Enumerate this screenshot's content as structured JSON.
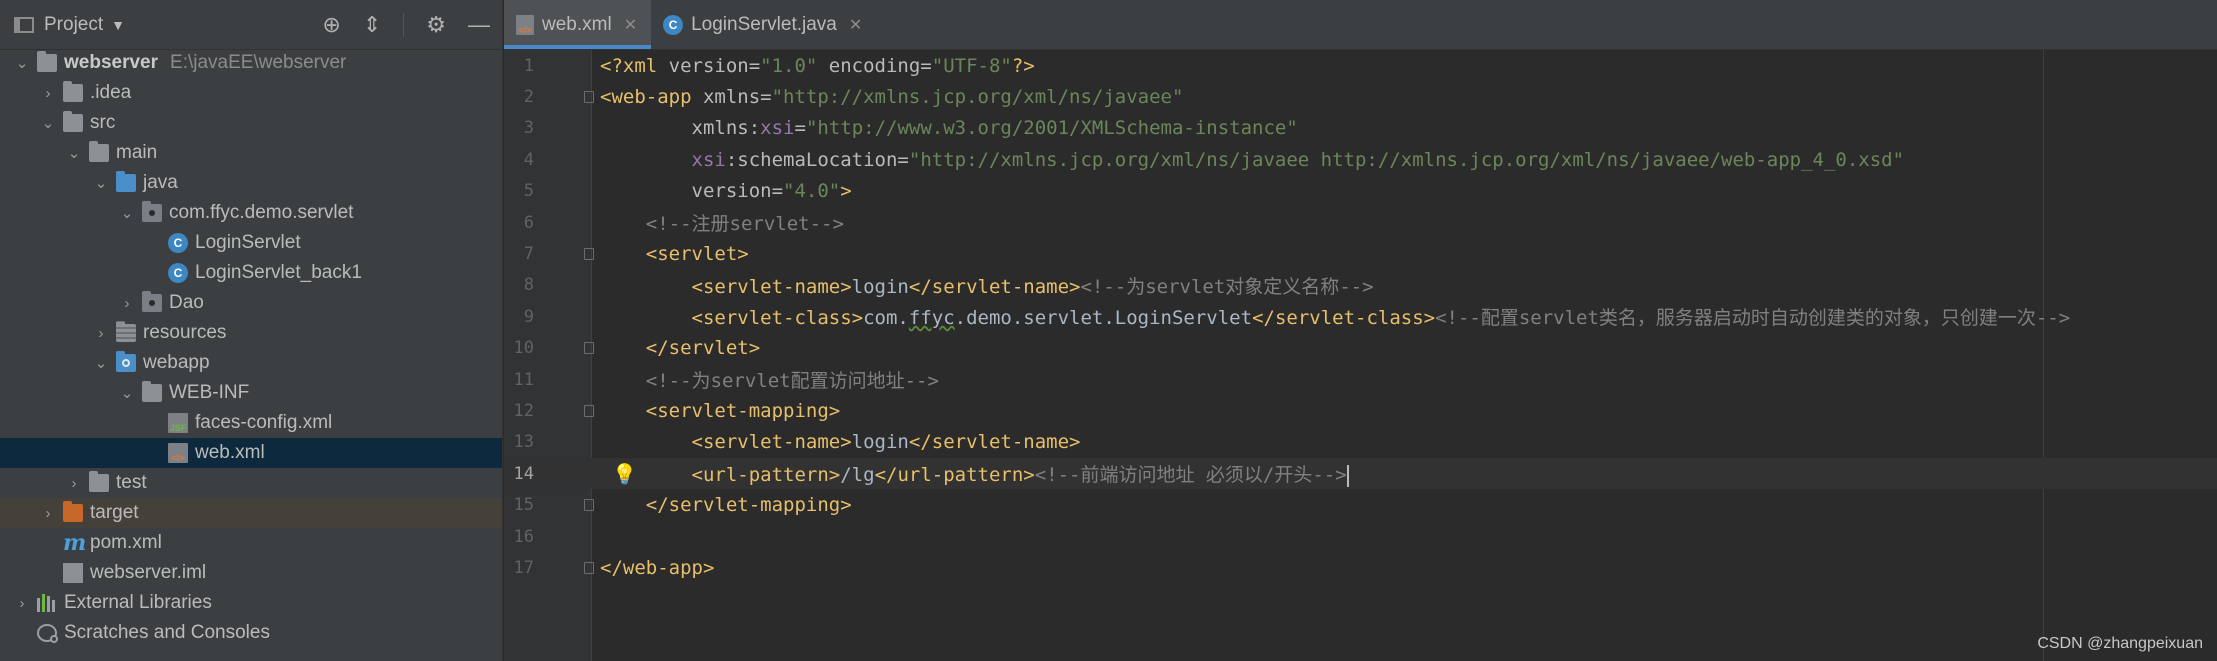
{
  "project_panel": {
    "title": "Project",
    "tree": [
      {
        "label": "webserver",
        "path": "E:\\javaEE\\webserver"
      },
      {
        "label": ".idea"
      },
      {
        "label": "src"
      },
      {
        "label": "main"
      },
      {
        "label": "java"
      },
      {
        "label": "com.ffyc.demo.servlet"
      },
      {
        "label": "LoginServlet"
      },
      {
        "label": "LoginServlet_back1"
      },
      {
        "label": "Dao"
      },
      {
        "label": "resources"
      },
      {
        "label": "webapp"
      },
      {
        "label": "WEB-INF"
      },
      {
        "label": "faces-config.xml"
      },
      {
        "label": "web.xml"
      },
      {
        "label": "test"
      },
      {
        "label": "target"
      },
      {
        "label": "pom.xml"
      },
      {
        "label": "webserver.iml"
      },
      {
        "label": "External Libraries"
      },
      {
        "label": "Scratches and Consoles"
      }
    ]
  },
  "editor": {
    "tabs": [
      {
        "label": "web.xml",
        "active": true
      },
      {
        "label": "LoginServlet.java",
        "active": false
      }
    ],
    "current_line": 14,
    "lines": [
      {
        "n": "1"
      },
      {
        "n": "2"
      },
      {
        "n": "3"
      },
      {
        "n": "4"
      },
      {
        "n": "5"
      },
      {
        "n": "6"
      },
      {
        "n": "7"
      },
      {
        "n": "8"
      },
      {
        "n": "9"
      },
      {
        "n": "10"
      },
      {
        "n": "11"
      },
      {
        "n": "12"
      },
      {
        "n": "13"
      },
      {
        "n": "14"
      },
      {
        "n": "15"
      },
      {
        "n": "16"
      },
      {
        "n": "17"
      }
    ],
    "code": {
      "l1_pi_open": "<?xml",
      "l1_attr1": " version=",
      "l1_val1": "\"1.0\"",
      "l1_attr2": " encoding=",
      "l1_val2": "\"UTF-8\"",
      "l1_pi_close": "?>",
      "l2_tag": "<web-app",
      "l2_attr": " xmlns=",
      "l2_val": "\"http://xmlns.jcp.org/xml/ns/javaee\"",
      "l3_attr": "xmlns:",
      "l3_ns": "xsi",
      "l3_eq": "=",
      "l3_val": "\"http://www.w3.org/2001/XMLSchema-instance\"",
      "l4_ns": "xsi",
      "l4_attr": ":schemaLocation=",
      "l4_val": "\"http://xmlns.jcp.org/xml/ns/javaee http://xmlns.jcp.org/xml/ns/javaee/web-app_4_0.xsd\"",
      "l5_attr": "version=",
      "l5_val": "\"4.0\"",
      "l5_close": ">",
      "l6_comment": "<!--注册servlet-->",
      "l7_tag": "<servlet>",
      "l8_open": "<servlet-name>",
      "l8_text": "login",
      "l8_close": "</servlet-name>",
      "l8_comment": "<!--为servlet对象定义名称-->",
      "l9_open": "<servlet-class>",
      "l9_text1": "com.",
      "l9_text2": "ffyc",
      "l9_text3": ".demo.servlet.LoginServlet",
      "l9_close": "</servlet-class>",
      "l9_comment": "<!--配置servlet类名，服务器启动时自动创建类的对象，只创建一次-->",
      "l10_tag": "</servlet>",
      "l11_comment": "<!--为servlet配置访问地址-->",
      "l12_tag": "<servlet-mapping>",
      "l13_open": "<servlet-name>",
      "l13_text": "login",
      "l13_close": "</servlet-name>",
      "l14_open": "<url-pattern>",
      "l14_text": "/lg",
      "l14_close": "</url-pattern>",
      "l14_comment": "<!--前端访问地址 必须以/开头-->",
      "l15_tag": "</servlet-mapping>",
      "l17_tag": "</web-app>"
    }
  },
  "watermark": "CSDN @zhangpeixuan"
}
